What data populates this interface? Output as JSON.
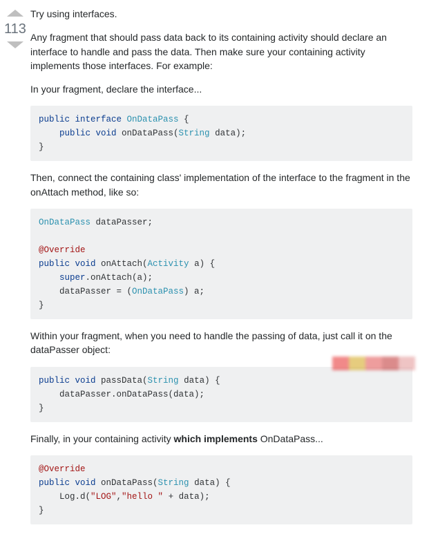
{
  "vote": {
    "score": "113"
  },
  "post": {
    "p0": "Try using interfaces.",
    "p1": "Any fragment that should pass data back to its containing activity should declare an interface to handle and pass the data. Then make sure your containing activity implements those interfaces. For example:",
    "p2": "In your fragment, declare the interface...",
    "p3": "Then, connect the containing class' implementation of the interface to the fragment in the onAttach method, like so:",
    "p4": "Within your fragment, when you need to handle the passing of data, just call it on the dataPasser object:",
    "p5_a": "Finally, in your containing activity ",
    "p5_b": "which implements",
    "p5_c": " OnDataPass..."
  },
  "code1": {
    "l1a": "public",
    "l1b": " interface",
    "l1c": " OnDataPass",
    "l1d": " {",
    "l2a": "    public",
    "l2b": " void",
    "l2c": " onDataPass(",
    "l2d": "String",
    "l2e": " data);",
    "l3": "}"
  },
  "code2": {
    "l1a": "OnDataPass",
    "l1b": " dataPasser;",
    "blank": "",
    "l2": "@Override",
    "l3a": "public",
    "l3b": " void",
    "l3c": " onAttach(",
    "l3d": "Activity",
    "l3e": " a) {",
    "l4a": "    super",
    "l4b": ".onAttach(a);",
    "l5a": "    dataPasser = (",
    "l5b": "OnDataPass",
    "l5c": ") a;",
    "l6": "}"
  },
  "code3": {
    "l1a": "public",
    "l1b": " void",
    "l1c": " passData(",
    "l1d": "String",
    "l1e": " data) {",
    "l2": "    dataPasser.onDataPass(data);",
    "l3": "}"
  },
  "code4": {
    "l1": "@Override",
    "l2a": "public",
    "l2b": " void",
    "l2c": " onDataPass(",
    "l2d": "String",
    "l2e": " data) {",
    "l3a": "    Log.d(",
    "l3b": "\"LOG\"",
    "l3c": ",",
    "l3d": "\"hello \"",
    "l3e": " + data);",
    "l4": "}"
  }
}
